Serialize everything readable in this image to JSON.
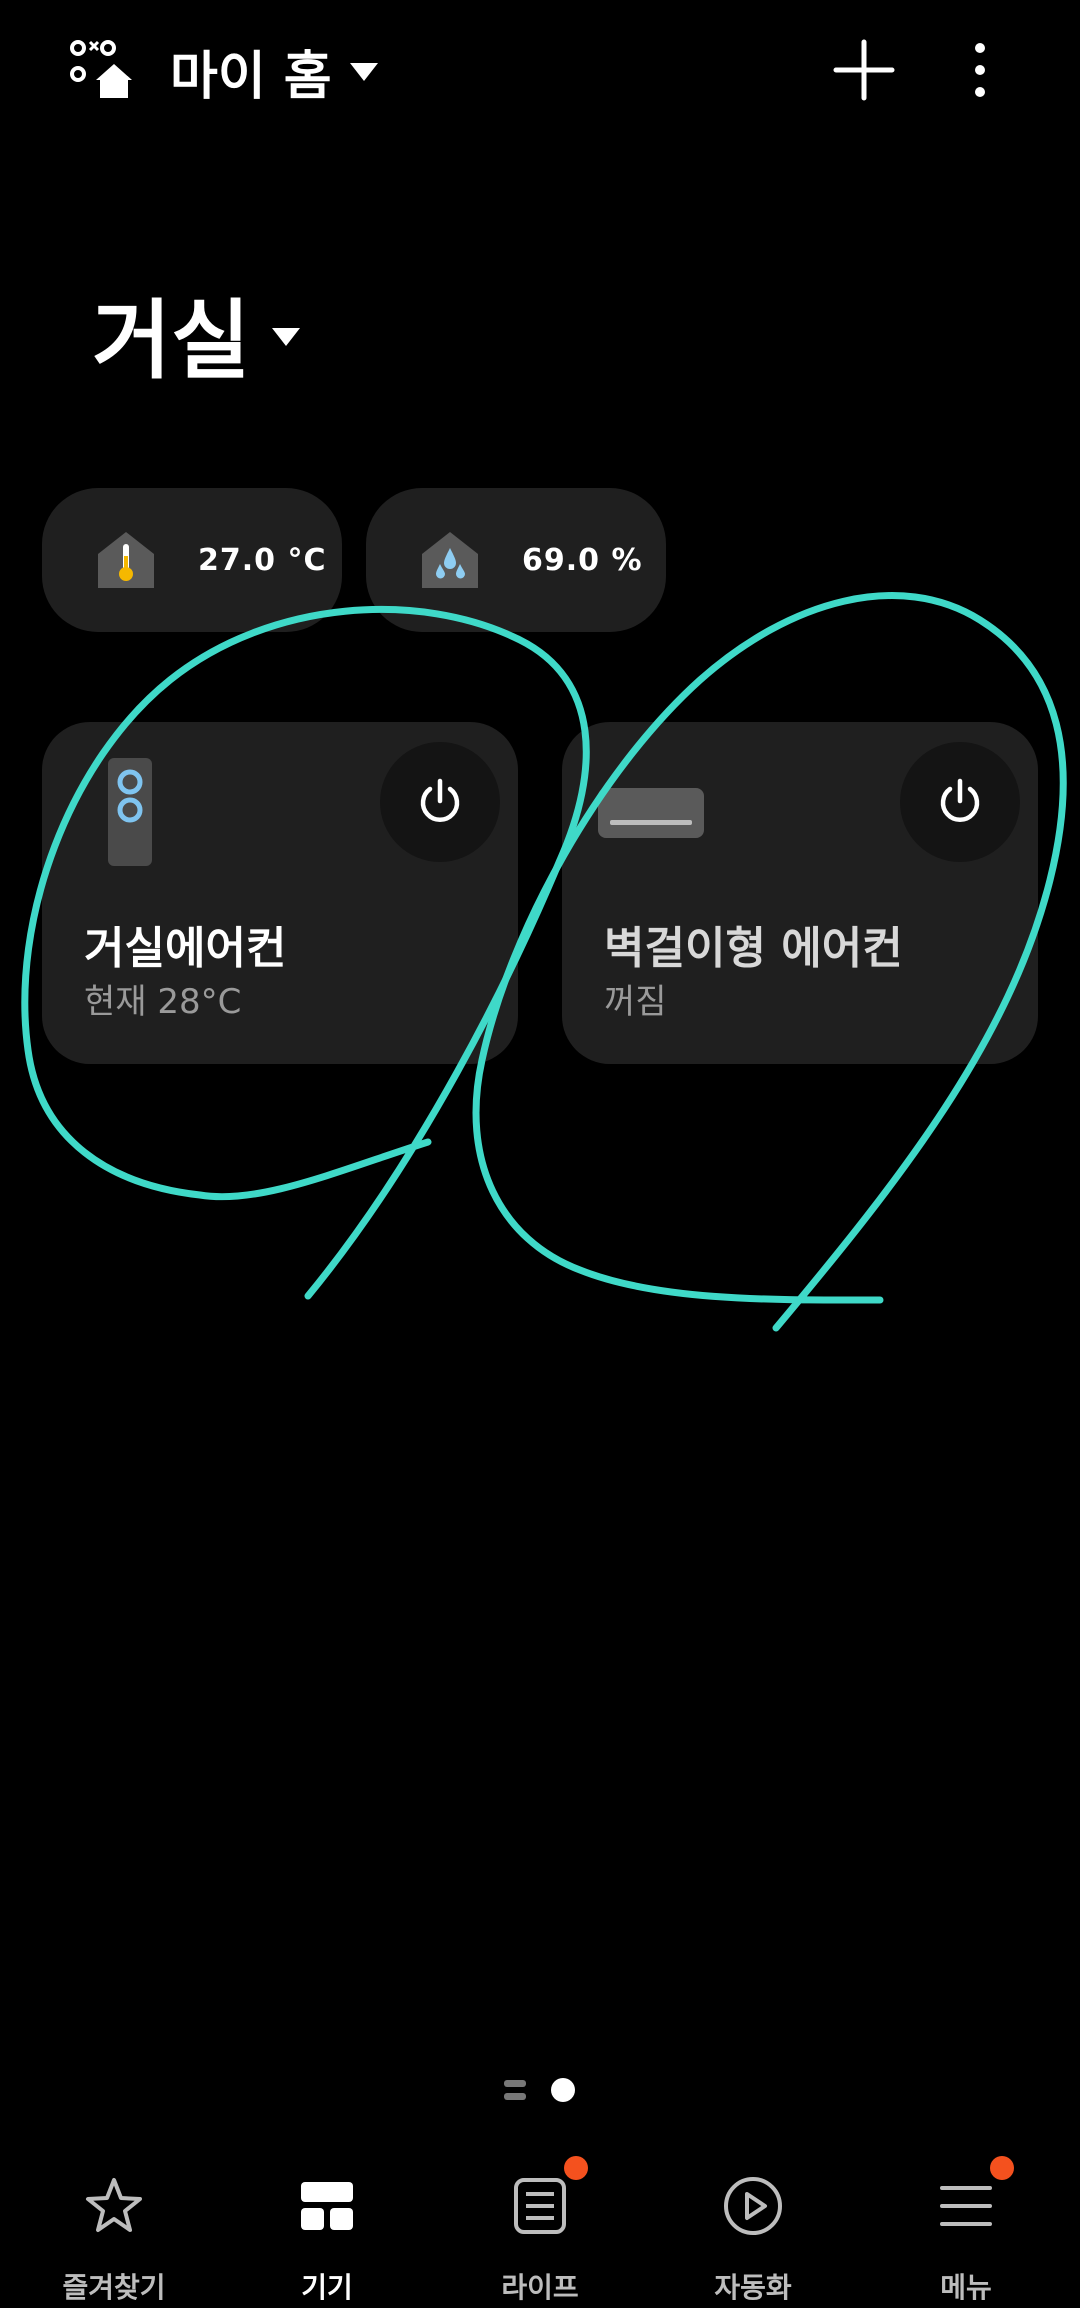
{
  "topbar": {
    "home_name": "마이 홈"
  },
  "room": {
    "name": "거실"
  },
  "sensors": [
    {
      "icon": "thermometer-home-icon",
      "value": "27.0 °C"
    },
    {
      "icon": "humidity-home-icon",
      "value": "69.0 %"
    }
  ],
  "devices": [
    {
      "name": "거실에어컨",
      "status": "현재 28°C",
      "icon": "standing-aircon-icon"
    },
    {
      "name": "벽걸이형 에어컨",
      "status": "꺼짐",
      "icon": "wall-aircon-icon"
    }
  ],
  "nav": [
    {
      "label": "즐겨찾기",
      "icon": "star-icon",
      "active": false,
      "badge": false
    },
    {
      "label": "기기",
      "icon": "devices-grid-icon",
      "active": true,
      "badge": false
    },
    {
      "label": "라이프",
      "icon": "life-icon",
      "active": false,
      "badge": true
    },
    {
      "label": "자동화",
      "icon": "play-circle-icon",
      "active": false,
      "badge": false
    },
    {
      "label": "메뉴",
      "icon": "menu-icon",
      "active": false,
      "badge": true
    }
  ],
  "colors": {
    "annotation": "#3fd9c8",
    "badge": "#f4511e",
    "card": "#1f1f1f"
  }
}
